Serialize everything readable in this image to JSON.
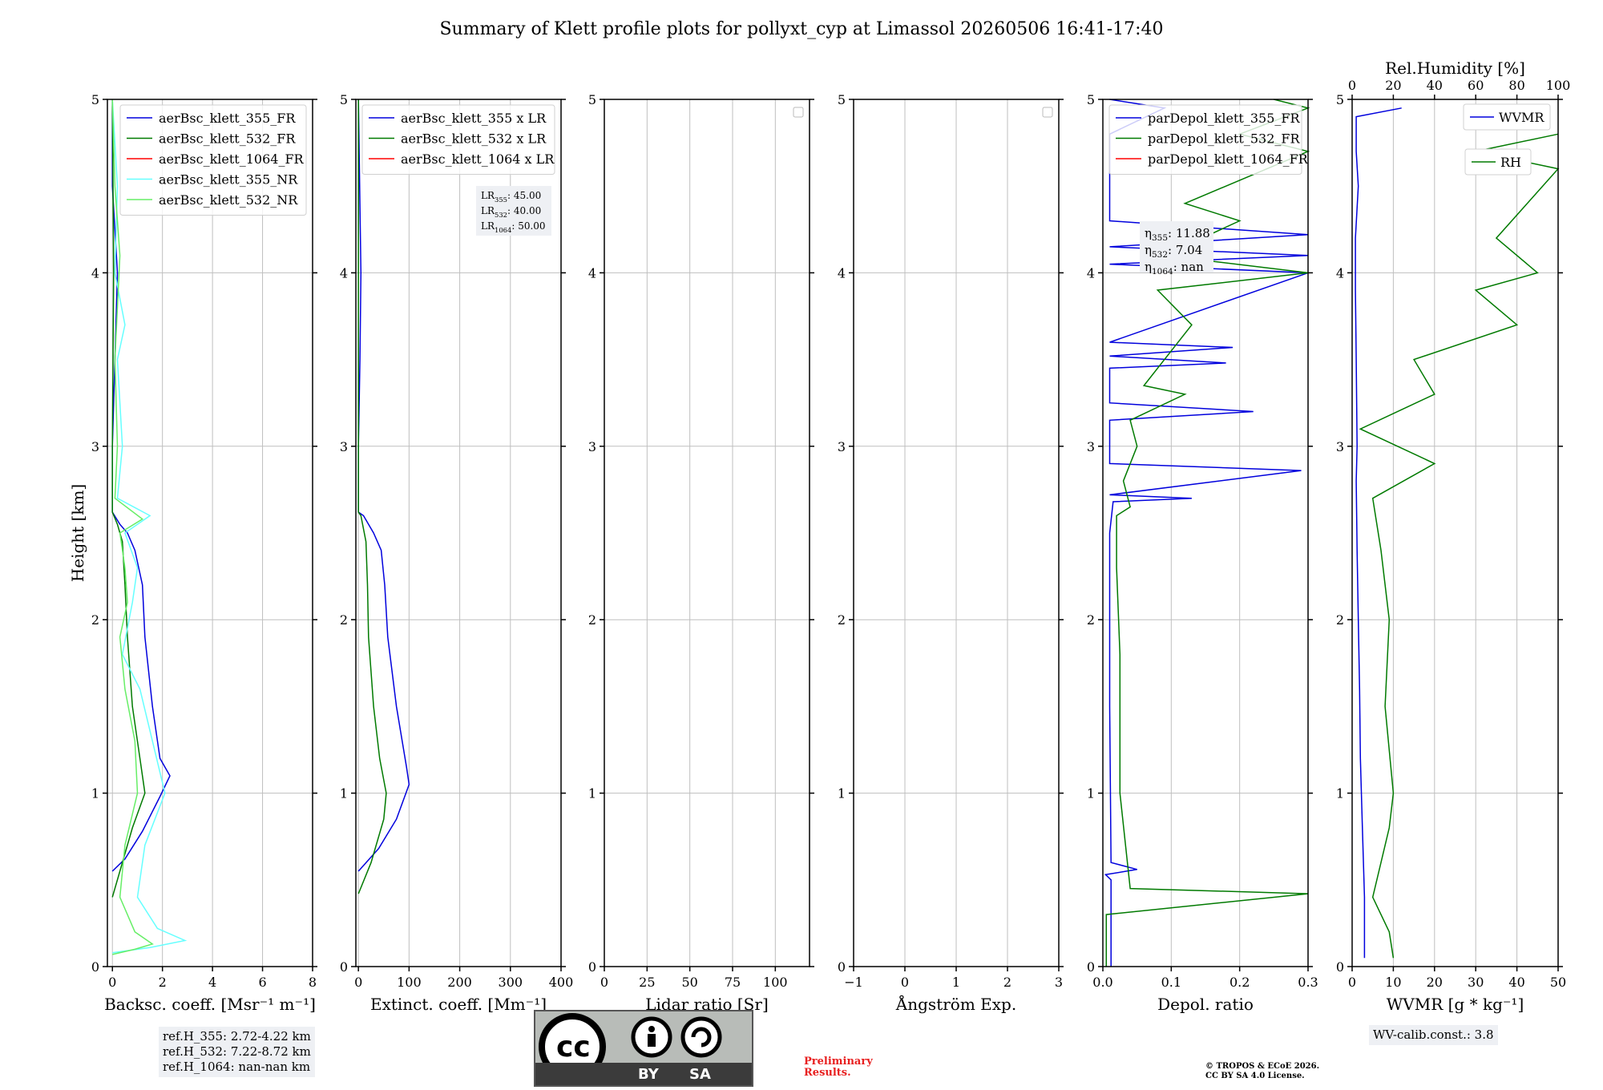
{
  "title": "Summary of Klett profile plots for pollyxt_cyp at Limassol 20260506 16:41-17:40",
  "colors": {
    "blue": "#0000dd",
    "green": "#007a00",
    "red": "#ff0000",
    "cyan": "#66ffff",
    "lightgreen": "#66ee66",
    "grid": "#bfbfbf"
  },
  "chart_data": [
    {
      "type": "line",
      "ylabel": "Height [km]",
      "xlabel": "Backsc. coeff. [Msr⁻¹ m⁻¹]",
      "xlim": [
        -0.2,
        8
      ],
      "ylim": [
        0,
        5
      ],
      "xticks": [
        "0",
        "2",
        "4",
        "6",
        "8"
      ],
      "yticks": [
        "0",
        "1",
        "2",
        "3",
        "4",
        "5"
      ],
      "legend": "top-right",
      "series": [
        {
          "name": "aerBsc_klett_355_FR",
          "color": "#0000dd",
          "points": [
            [
              0,
              0.55
            ],
            [
              0.5,
              0.62
            ],
            [
              1.2,
              0.78
            ],
            [
              1.9,
              0.98
            ],
            [
              2.3,
              1.1
            ],
            [
              1.9,
              1.2
            ],
            [
              1.6,
              1.5
            ],
            [
              1.3,
              1.9
            ],
            [
              1.2,
              2.2
            ],
            [
              0.9,
              2.4
            ],
            [
              0.6,
              2.5
            ],
            [
              0.3,
              2.55
            ],
            [
              0,
              2.62
            ],
            [
              0,
              3
            ],
            [
              0.1,
              3.5
            ],
            [
              0.2,
              4
            ],
            [
              0,
              4.5
            ],
            [
              0,
              5
            ]
          ]
        },
        {
          "name": "aerBsc_klett_532_FR",
          "color": "#007a00",
          "points": [
            [
              0,
              0.4
            ],
            [
              0.3,
              0.55
            ],
            [
              0.8,
              0.8
            ],
            [
              1.3,
              1
            ],
            [
              1.1,
              1.2
            ],
            [
              0.8,
              1.5
            ],
            [
              0.6,
              1.9
            ],
            [
              0.5,
              2.2
            ],
            [
              0.4,
              2.45
            ],
            [
              0.2,
              2.55
            ],
            [
              0,
              2.62
            ],
            [
              0,
              3
            ],
            [
              0.05,
              4
            ],
            [
              0,
              5
            ]
          ]
        },
        {
          "name": "aerBsc_klett_1064_FR",
          "color": "#ff0000",
          "points": []
        },
        {
          "name": "aerBsc_klett_355_NR",
          "color": "#66ffff",
          "points": [
            [
              0,
              0.08
            ],
            [
              1.5,
              0.11
            ],
            [
              2.9,
              0.15
            ],
            [
              1.8,
              0.22
            ],
            [
              1.0,
              0.4
            ],
            [
              1.3,
              0.7
            ],
            [
              2.1,
              1.0
            ],
            [
              1.6,
              1.3
            ],
            [
              1.1,
              1.6
            ],
            [
              0.4,
              1.8
            ],
            [
              0.8,
              2.1
            ],
            [
              1.0,
              2.3
            ],
            [
              0.5,
              2.5
            ],
            [
              1.5,
              2.6
            ],
            [
              0.2,
              2.7
            ],
            [
              0.4,
              3.0
            ],
            [
              0.2,
              3.5
            ],
            [
              0.5,
              3.7
            ],
            [
              0.1,
              4
            ],
            [
              0.2,
              4.5
            ],
            [
              0,
              5
            ]
          ]
        },
        {
          "name": "aerBsc_klett_532_NR",
          "color": "#66ee66",
          "points": [
            [
              0,
              0.07
            ],
            [
              0.9,
              0.1
            ],
            [
              1.6,
              0.13
            ],
            [
              0.9,
              0.2
            ],
            [
              0.3,
              0.4
            ],
            [
              0.5,
              0.7
            ],
            [
              1.0,
              1.0
            ],
            [
              0.9,
              1.3
            ],
            [
              0.5,
              1.6
            ],
            [
              0.3,
              1.9
            ],
            [
              0.6,
              2.1
            ],
            [
              0.5,
              2.3
            ],
            [
              0.3,
              2.5
            ],
            [
              1.2,
              2.58
            ],
            [
              0.1,
              2.7
            ],
            [
              0.2,
              3
            ],
            [
              0.1,
              3.5
            ],
            [
              0.3,
              4.1
            ],
            [
              0.1,
              4.5
            ],
            [
              0,
              5
            ]
          ]
        }
      ],
      "info_box": [
        "ref.H_355: 2.72-4.22 km",
        "ref.H_532: 7.22-8.72 km",
        "ref.H_1064: nan-nan km"
      ]
    },
    {
      "type": "line",
      "xlabel": "Extinct. coeff. [Mm⁻¹]",
      "xlim": [
        -5,
        400
      ],
      "ylim": [
        0,
        5
      ],
      "xticks": [
        "0",
        "100",
        "200",
        "300",
        "400"
      ],
      "yticks": [
        "0",
        "1",
        "2",
        "3",
        "4",
        "5"
      ],
      "legend": "top-right",
      "series": [
        {
          "name": "aerBsc_klett_355 x LR",
          "color": "#0000dd",
          "points": [
            [
              0,
              0.55
            ],
            [
              40,
              0.68
            ],
            [
              75,
              0.85
            ],
            [
              100,
              1.05
            ],
            [
              95,
              1.15
            ],
            [
              75,
              1.5
            ],
            [
              58,
              1.9
            ],
            [
              52,
              2.2
            ],
            [
              45,
              2.4
            ],
            [
              30,
              2.5
            ],
            [
              10,
              2.6
            ],
            [
              0,
              2.62
            ],
            [
              0,
              3
            ],
            [
              3,
              3.5
            ],
            [
              5,
              4
            ],
            [
              0,
              5
            ]
          ]
        },
        {
          "name": "aerBsc_klett_532 x LR",
          "color": "#007a00",
          "points": [
            [
              0,
              0.42
            ],
            [
              25,
              0.6
            ],
            [
              50,
              0.85
            ],
            [
              55,
              1.0
            ],
            [
              42,
              1.2
            ],
            [
              30,
              1.5
            ],
            [
              20,
              1.9
            ],
            [
              18,
              2.2
            ],
            [
              15,
              2.45
            ],
            [
              5,
              2.6
            ],
            [
              0,
              2.62
            ],
            [
              0,
              5
            ]
          ]
        },
        {
          "name": "aerBsc_klett_1064 x LR",
          "color": "#ff0000",
          "points": []
        }
      ],
      "info_box": [
        "LR355: 45.00",
        "LR532: 40.00",
        "LR1064: 50.00"
      ]
    },
    {
      "type": "line",
      "xlabel": "Lidar ratio [Sr]",
      "xlim": [
        0,
        120
      ],
      "ylim": [
        0,
        5
      ],
      "xticks": [
        "0",
        "25",
        "50",
        "75",
        "100"
      ],
      "yticks": [
        "0",
        "1",
        "2",
        "3",
        "4",
        "5"
      ],
      "series": []
    },
    {
      "type": "line",
      "xlabel": "Ångström Exp.",
      "xlim": [
        -1,
        3
      ],
      "ylim": [
        0,
        5
      ],
      "xticks": [
        "−1",
        "0",
        "1",
        "2",
        "3"
      ],
      "yticks": [
        "0",
        "1",
        "2",
        "3",
        "4",
        "5"
      ],
      "series": []
    },
    {
      "type": "line",
      "xlabel": "Depol. ratio",
      "xlim": [
        0,
        0.3
      ],
      "ylim": [
        0,
        5
      ],
      "xticks": [
        "0.0",
        "0.1",
        "0.2",
        "0.3"
      ],
      "yticks": [
        "0",
        "1",
        "2",
        "3",
        "4",
        "5"
      ],
      "legend": "top-right",
      "series": [
        {
          "name": "parDepol_klett_355_FR",
          "color": "#0000dd",
          "points": [
            [
              0.012,
              0
            ],
            [
              0.012,
              0.5
            ],
            [
              0.004,
              0.53
            ],
            [
              0.05,
              0.56
            ],
            [
              0.012,
              0.6
            ],
            [
              0.01,
              1.5
            ],
            [
              0.01,
              2.5
            ],
            [
              0.015,
              2.68
            ],
            [
              0.13,
              2.7
            ],
            [
              0.01,
              2.72
            ],
            [
              0.29,
              2.86
            ],
            [
              0.01,
              2.9
            ],
            [
              0.01,
              3.15
            ],
            [
              0.22,
              3.2
            ],
            [
              0.01,
              3.25
            ],
            [
              0.01,
              3.45
            ],
            [
              0.18,
              3.48
            ],
            [
              0.01,
              3.52
            ],
            [
              0.19,
              3.57
            ],
            [
              0.01,
              3.6
            ],
            [
              0.3,
              4.0
            ],
            [
              0.01,
              4.05
            ],
            [
              0.3,
              4.1
            ],
            [
              0.01,
              4.15
            ],
            [
              0.3,
              4.22
            ],
            [
              0.01,
              4.3
            ],
            [
              0.01,
              4.8
            ],
            [
              0.09,
              4.95
            ],
            [
              0.01,
              5
            ]
          ]
        },
        {
          "name": "parDepol_klett_532_FR",
          "color": "#007a00",
          "points": [
            [
              0.005,
              0
            ],
            [
              0.005,
              0.3
            ],
            [
              0.3,
              0.42
            ],
            [
              0.04,
              0.45
            ],
            [
              0.025,
              1.0
            ],
            [
              0.025,
              1.8
            ],
            [
              0.02,
              2.3
            ],
            [
              0.02,
              2.6
            ],
            [
              0.04,
              2.65
            ],
            [
              0.03,
              2.8
            ],
            [
              0.05,
              3.0
            ],
            [
              0.04,
              3.15
            ],
            [
              0.12,
              3.3
            ],
            [
              0.06,
              3.35
            ],
            [
              0.13,
              3.7
            ],
            [
              0.08,
              3.9
            ],
            [
              0.3,
              4.0
            ],
            [
              0.09,
              4.1
            ],
            [
              0.2,
              4.3
            ],
            [
              0.12,
              4.4
            ],
            [
              0.3,
              4.7
            ],
            [
              0.2,
              4.8
            ],
            [
              0.3,
              4.95
            ],
            [
              0.25,
              5
            ]
          ]
        },
        {
          "name": "parDepol_klett_1064_FR",
          "color": "#ff0000",
          "points": []
        }
      ],
      "info_box": [
        "η355: 11.88",
        "η532: 7.04",
        "η1064: nan"
      ]
    },
    {
      "type": "line",
      "xlabel": "WVMR [g * kg⁻¹]",
      "x2label": "Rel.Humidity [%]",
      "xlim": [
        0,
        50
      ],
      "x2lim": [
        0,
        100
      ],
      "ylim": [
        0,
        5
      ],
      "xticks": [
        "0",
        "10",
        "20",
        "30",
        "40",
        "50"
      ],
      "x2ticks": [
        "0",
        "20",
        "40",
        "60",
        "80",
        "100"
      ],
      "yticks": [
        "0",
        "1",
        "2",
        "3",
        "4",
        "5"
      ],
      "series": [
        {
          "name": "WVMR",
          "color": "#0000dd",
          "points": [
            [
              3,
              0.05
            ],
            [
              3,
              0.4
            ],
            [
              2.5,
              0.8
            ],
            [
              2,
              1.2
            ],
            [
              1.8,
              1.6
            ],
            [
              1.5,
              2.0
            ],
            [
              1.2,
              2.4
            ],
            [
              1.0,
              2.8
            ],
            [
              1.2,
              3.0
            ],
            [
              1.0,
              3.5
            ],
            [
              0.8,
              3.9
            ],
            [
              0.8,
              4.2
            ],
            [
              1.5,
              4.5
            ],
            [
              1.0,
              4.7
            ],
            [
              1.0,
              4.9
            ],
            [
              12,
              4.95
            ]
          ]
        },
        {
          "name": "RH",
          "color": "#007a00",
          "axis": "x2",
          "points": [
            [
              20,
              0.05
            ],
            [
              18,
              0.2
            ],
            [
              10,
              0.4
            ],
            [
              18,
              0.8
            ],
            [
              20,
              1.0
            ],
            [
              16,
              1.5
            ],
            [
              18,
              2.0
            ],
            [
              14,
              2.4
            ],
            [
              10,
              2.7
            ],
            [
              40,
              2.9
            ],
            [
              4,
              3.1
            ],
            [
              40,
              3.3
            ],
            [
              30,
              3.5
            ],
            [
              80,
              3.7
            ],
            [
              60,
              3.9
            ],
            [
              90,
              4.0
            ],
            [
              70,
              4.2
            ],
            [
              100,
              4.6
            ],
            [
              60,
              4.7
            ],
            [
              100,
              4.8
            ]
          ]
        }
      ],
      "info_box": [
        "WV-calib.const.: 3.8"
      ]
    }
  ],
  "license": {
    "cc": "cc",
    "by": "BY",
    "sa": "SA"
  },
  "preliminary": [
    "Preliminary",
    "Results."
  ],
  "copyright": [
    "© TROPOS & ECoE 2026.",
    "CC BY SA 4.0 License."
  ]
}
